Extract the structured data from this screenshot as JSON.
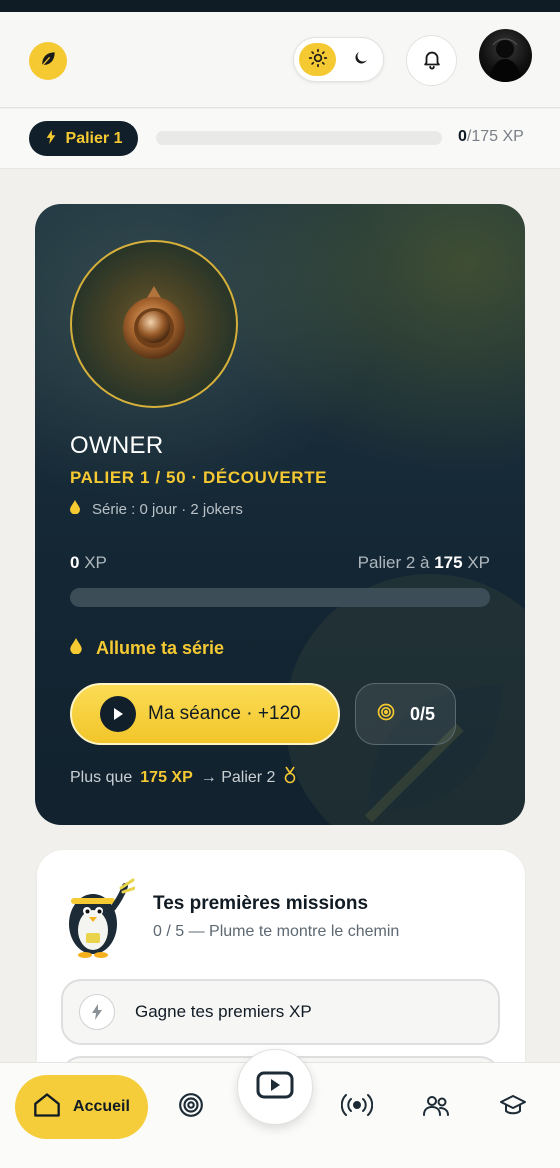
{
  "header": {
    "logo_icon": "leaf-icon",
    "theme_options": [
      "sun-icon",
      "moon-icon"
    ],
    "theme_selected": "light",
    "notification_icon": "bell-icon",
    "accent_color": "#f5c932"
  },
  "xp_bar": {
    "tier_label": "Palier 1",
    "current": "0",
    "total": "/175 XP",
    "progress_fraction": 0
  },
  "hero": {
    "name": "OWNER",
    "tier_line": "PALIER 1 / 50 · DÉCOUVERTE",
    "streak_line": "Série : 0 jour · 2 jokers",
    "xp_current": "0",
    "xp_unit": " XP",
    "next_prefix": "Palier 2 à ",
    "next_value": "175",
    "next_unit": " XP",
    "progress_fraction": 0,
    "streak_prompt": "Allume ta série",
    "session_button": "Ma séance · +120",
    "missions_count": "0/5",
    "remaining_prefix": "Plus que",
    "remaining_value": "175 XP",
    "remaining_suffix": "→ Palier 2"
  },
  "missions": {
    "title": "Tes premières missions",
    "subtitle": "0 / 5 — Plume te montre le chemin",
    "items": [
      {
        "label": "Gagne tes premiers XP",
        "icon": "bolt-icon"
      }
    ]
  },
  "nav": {
    "home_label": "Accueil",
    "items": [
      "home-icon",
      "target-icon",
      "play-icon",
      "broadcast-icon",
      "users-icon",
      "graduation-cap-icon"
    ]
  }
}
